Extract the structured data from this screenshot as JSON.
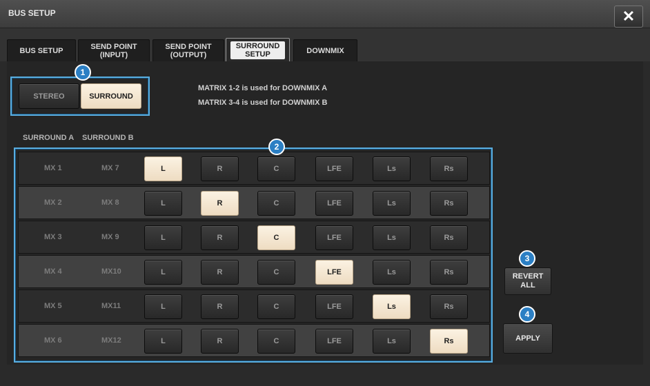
{
  "window": {
    "title": "BUS SETUP",
    "close_label": "✕"
  },
  "tabs": [
    {
      "label": "BUS SETUP",
      "active": false
    },
    {
      "label": "SEND POINT\n(INPUT)",
      "active": false
    },
    {
      "label": "SEND POINT\n(OUTPUT)",
      "active": false
    },
    {
      "label": "SURROUND\nSETUP",
      "active": true
    },
    {
      "label": "DOWNMIX",
      "active": false
    }
  ],
  "mode": {
    "badge": "1",
    "stereo_label": "STEREO",
    "surround_label": "SURROUND",
    "selected": "SURROUND"
  },
  "info": {
    "line1": "MATRIX 1-2 is used for DOWNMIX A",
    "line2": "MATRIX 3-4 is used for DOWNMIX B"
  },
  "headers": {
    "surround_a": "SURROUND A",
    "surround_b": "SURROUND B"
  },
  "grid_badge": "2",
  "channels": [
    "L",
    "R",
    "C",
    "LFE",
    "Ls",
    "Rs"
  ],
  "rows": [
    {
      "a": "MX 1",
      "b": "MX 7",
      "selected": "L"
    },
    {
      "a": "MX 2",
      "b": "MX 8",
      "selected": "R"
    },
    {
      "a": "MX 3",
      "b": "MX 9",
      "selected": "C"
    },
    {
      "a": "MX 4",
      "b": "MX10",
      "selected": "LFE"
    },
    {
      "a": "MX 5",
      "b": "MX11",
      "selected": "Ls"
    },
    {
      "a": "MX 6",
      "b": "MX12",
      "selected": "Rs"
    }
  ],
  "revert": {
    "badge": "3",
    "label": "REVERT\nALL"
  },
  "apply": {
    "badge": "4",
    "label": "APPLY"
  },
  "colors": {
    "accent": "#5aaee0",
    "badge": "#2b7fc4",
    "selected": "#f6e8d2"
  }
}
